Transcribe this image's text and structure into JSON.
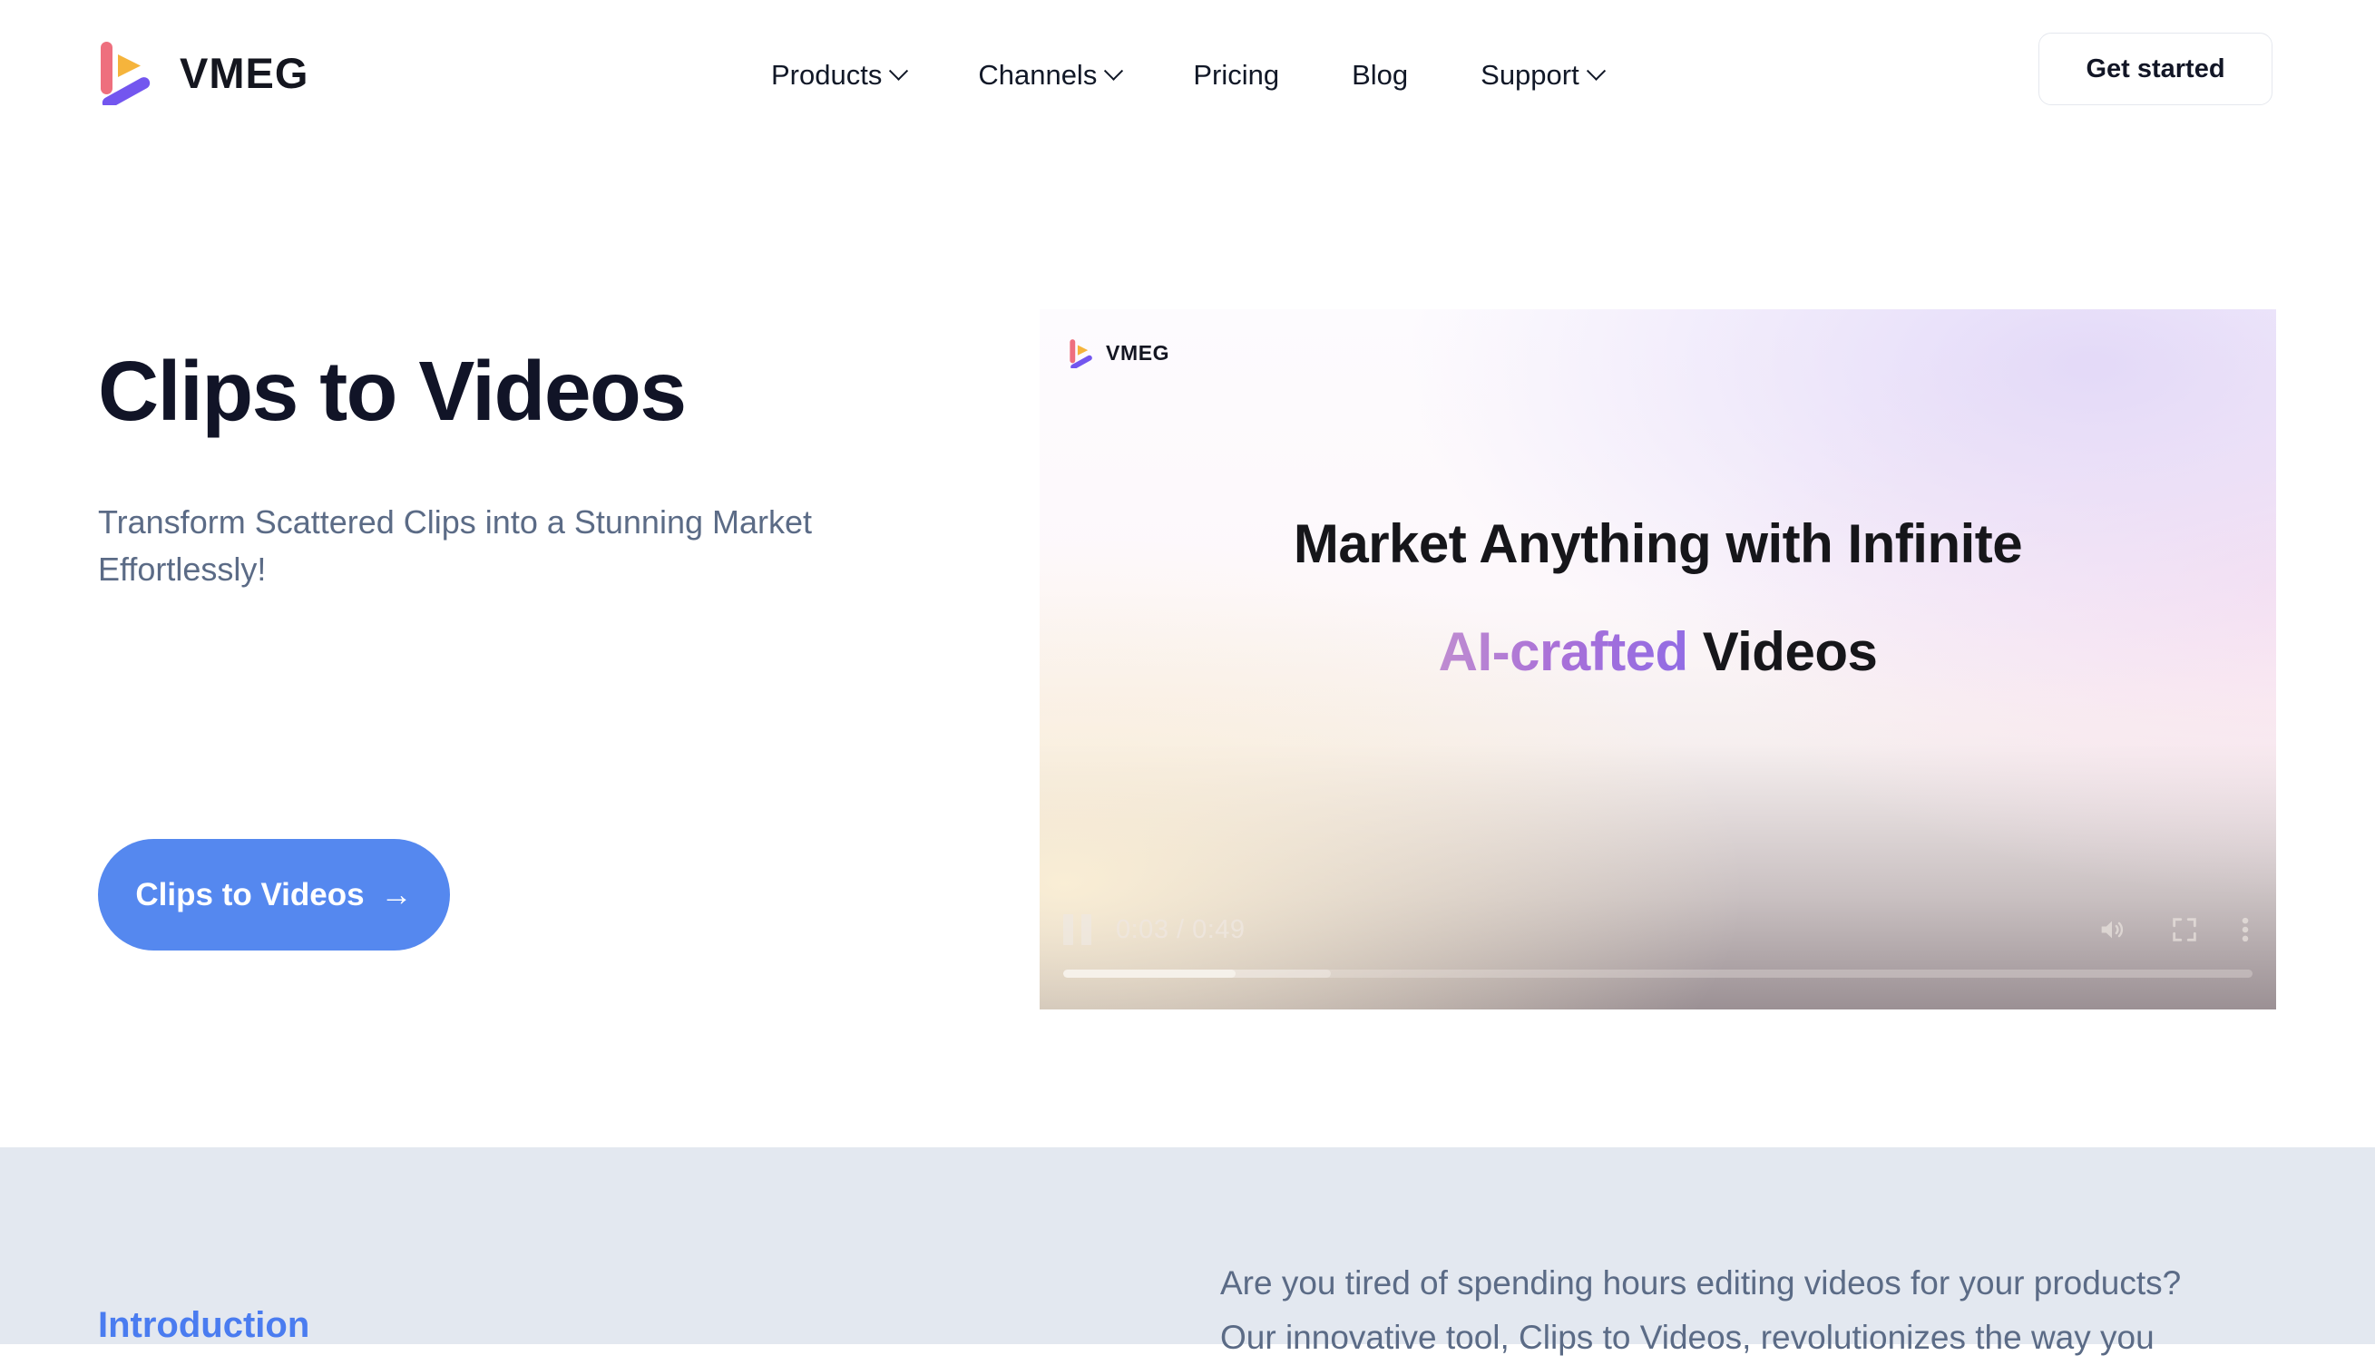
{
  "header": {
    "brand": {
      "name": "VMEG",
      "logo_icon": "vmeg-play-logo"
    },
    "nav": [
      {
        "label": "Products",
        "has_dropdown": true
      },
      {
        "label": "Channels",
        "has_dropdown": true
      },
      {
        "label": "Pricing",
        "has_dropdown": false
      },
      {
        "label": "Blog",
        "has_dropdown": false
      },
      {
        "label": "Support",
        "has_dropdown": true
      }
    ],
    "cta": {
      "label": "Get started"
    }
  },
  "hero": {
    "title": "Clips to Videos",
    "subtitle": "Transform Scattered Clips into a Stunning Market Effortlessly!",
    "cta_label": "Clips to Videos",
    "cta_arrow": "→"
  },
  "video": {
    "watermark": "VMEG",
    "watermark_icon": "vmeg-play-logo",
    "caption_line1": "Market Anything with Infinite",
    "caption_highlight": "AI-crafted",
    "caption_suffix": "Videos",
    "controls": {
      "pause_icon": "pause-icon",
      "time": "0:03 / 0:49",
      "current_time": "0:03",
      "duration": "0:49",
      "volume_icon": "volume-icon",
      "fullscreen_icon": "fullscreen-icon",
      "more_icon": "more-vertical-icon",
      "played_percent": 6,
      "buffered_percent": 22
    }
  },
  "intro": {
    "title": "Introduction",
    "paragraph_line1": "Are you tired of spending hours editing videos for your products?",
    "paragraph_line2": "Our innovative tool, Clips to Videos, revolutionizes the way you"
  },
  "colors": {
    "accent_blue": "#5588ef",
    "link_blue": "#4a7cf0",
    "text_dark": "#111427",
    "text_muted": "#5b6b86",
    "section_bg": "#e3e8f0",
    "logo_pink": "#ee6f7e",
    "logo_orange": "#f5b43c",
    "logo_purple": "#7356ef"
  }
}
